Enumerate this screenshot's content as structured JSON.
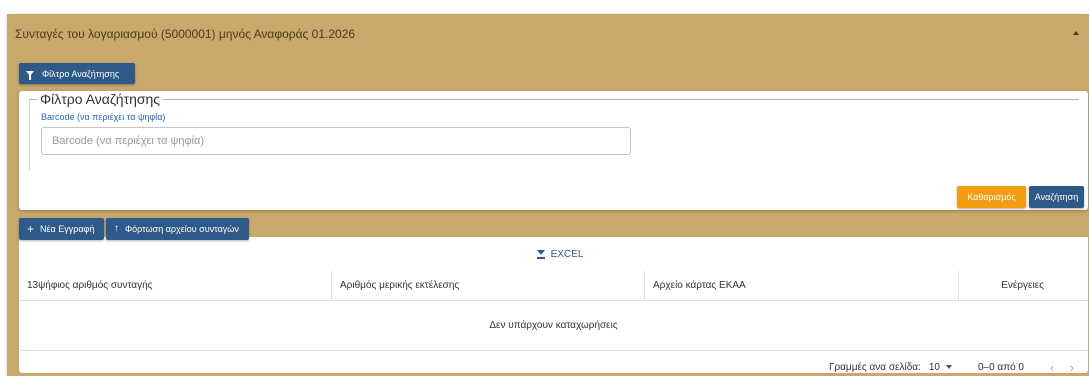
{
  "panel": {
    "title": "Συνταγές του λογαριασμού (5000001) μηνός Αναφοράς 01.2026",
    "colors": {
      "header_bg": "#c8a86b",
      "primary": "#2e5a8a",
      "warning": "#f39c12",
      "label_blue": "#2a6ab8"
    }
  },
  "filter_toggle": {
    "label": "Φίλτρο Αναζήτησης",
    "icon": "filter-icon"
  },
  "filter": {
    "legend": "Φίλτρο Αναζήτησης",
    "barcode_label": "Barcode (να περιέχει τα ψηφία)",
    "barcode_placeholder": "Barcode (να περιέχει τα ψηφία)",
    "barcode_value": "",
    "clear_label": "Καθαρισμός",
    "search_label": "Αναζήτηση"
  },
  "actions": {
    "new_label": "Νέα Εγγραφή",
    "new_icon": "plus-icon",
    "upload_label": "Φόρτωση αρχείου συνταγών",
    "upload_icon": "arrow-up-icon"
  },
  "table": {
    "export_label": "EXCEL",
    "export_icon": "download-icon",
    "columns": [
      "13ψήφιος αριθμός συνταγής",
      "Αριθμός μερικής εκτέλεσης",
      "Αρχείο κάρτας ΕΚΑΑ",
      "Ενέργειες"
    ],
    "empty_message": "Δεν υπάρχουν καταχωρήσεις",
    "pagination": {
      "rows_per_page_label": "Γραμμές ανα σελίδα:",
      "rows_per_page": "10",
      "range": "0–0 από 0",
      "prev": "‹",
      "next": "›"
    }
  }
}
